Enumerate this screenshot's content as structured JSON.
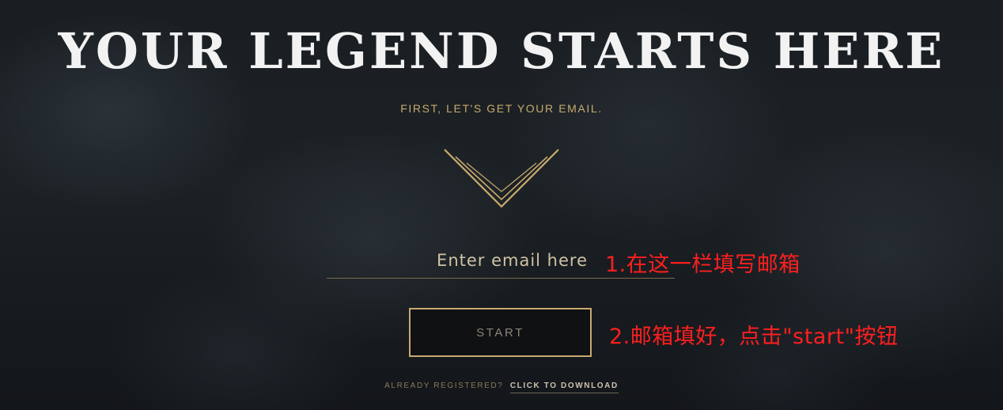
{
  "hero": {
    "title": "YOUR LEGEND STARTS HERE",
    "subtitle": "FIRST, LET'S GET YOUR EMAIL."
  },
  "form": {
    "email_placeholder": "Enter email here",
    "email_value": "",
    "start_label": "START"
  },
  "annotations": {
    "step1": "1.在这一栏填写邮箱",
    "step2": "2.邮箱填好，点击\"start\"按钮"
  },
  "footer": {
    "already_registered": "ALREADY REGISTERED?",
    "download_link": "CLICK TO DOWNLOAD"
  },
  "colors": {
    "gold": "#c8aa6e",
    "annotation_red": "#ff1f1f",
    "background": "#15181b"
  }
}
